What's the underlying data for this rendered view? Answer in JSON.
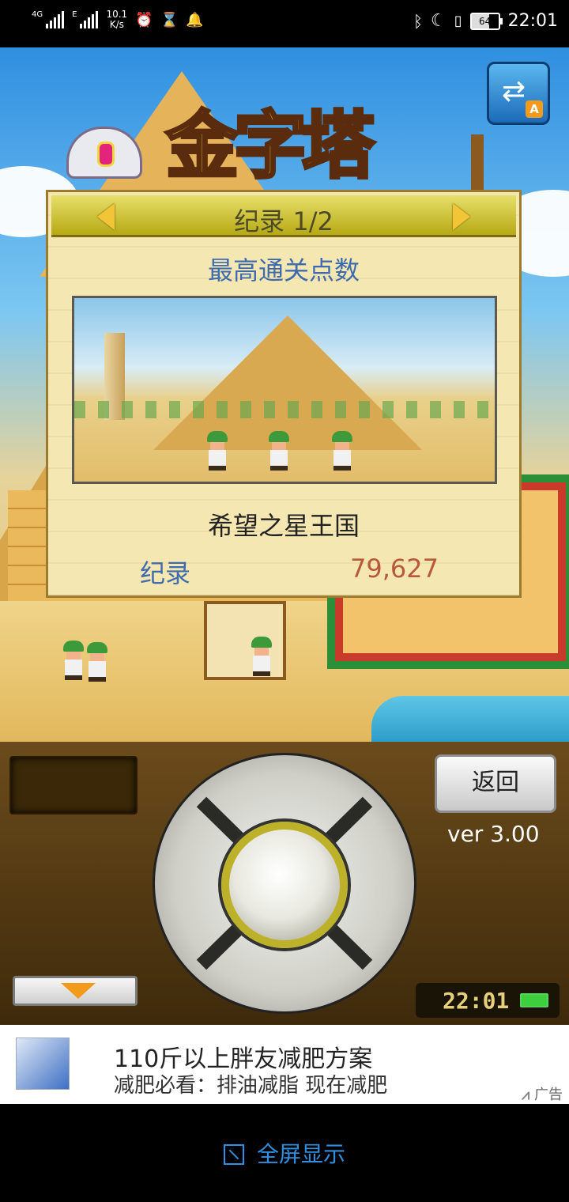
{
  "status_bar": {
    "signal1_label": "4G",
    "signal2_label": "E",
    "net_speed_value": "10.1",
    "net_speed_unit": "K/s",
    "battery_level": "64",
    "time": "22:01"
  },
  "game": {
    "title_art": "金字塔",
    "dialog": {
      "title": "纪录 1/2",
      "subtitle": "最高通关点数",
      "kingdom_name": "希望之星王国",
      "record_label": "纪录",
      "record_value": "79,627"
    },
    "back_button": "返回",
    "version": "ver 3.00",
    "clock": "22:01"
  },
  "ad": {
    "title": "110斤以上胖友减肥方案",
    "description": "减肥必看：排油减脂 现在减肥",
    "tag": "广告"
  },
  "bottom": {
    "fullscreen_label": "全屏显示"
  },
  "colors": {
    "dialog_subtitle": "#3d6bb0",
    "record_value": "#b8593a",
    "fullscreen": "#2f8fe0"
  }
}
